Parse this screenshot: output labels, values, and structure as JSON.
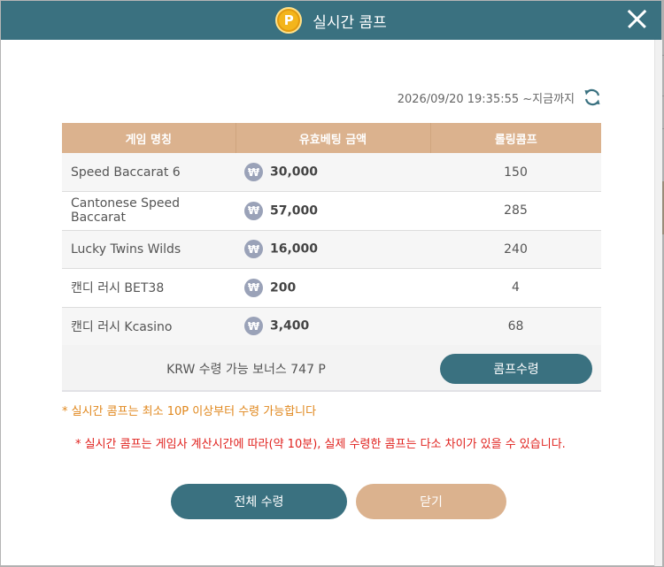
{
  "modal": {
    "coin_symbol": "P",
    "title": "실시간 콤프"
  },
  "timestamp": "2026/09/20 19:35:55 ~지금까지",
  "table": {
    "headers": [
      "게임 명칭",
      "유효베팅 금액",
      "롤링콤프"
    ],
    "currency_symbol": "₩",
    "rows": [
      {
        "game": "Speed Baccarat 6",
        "bet": "30,000",
        "comp": "150"
      },
      {
        "game": "Cantonese Speed Baccarat",
        "bet": "57,000",
        "comp": "285"
      },
      {
        "game": "Lucky Twins Wilds",
        "bet": "16,000",
        "comp": "240"
      },
      {
        "game": "캔디 러시 BET38",
        "bet": "200",
        "comp": "4"
      },
      {
        "game": "캔디 러시 Kcasino",
        "bet": "3,400",
        "comp": "68"
      }
    ]
  },
  "bonus": {
    "text": "KRW 수령 가능 보너스 747 P",
    "button_label": "콤프수령"
  },
  "notes": {
    "orange": "* 실시간 콤프는 최소 10P 이상부터 수령 가능합니다",
    "red": "* 실시간 콤프는 게임사 계산시간에 따라(약 10분), 실제 수령한 콤프는 다소 차이가 있을 수 있습니다."
  },
  "buttons": {
    "receive_all": "전체 수령",
    "close": "닫기"
  },
  "colors": {
    "header_teal": "#3a7180",
    "table_header_tan": "#dbb28e",
    "note_orange": "#e0871c",
    "note_red": "#e0211d"
  },
  "icons": [
    "coin-icon",
    "close-icon",
    "refresh-icon",
    "won-icon"
  ]
}
